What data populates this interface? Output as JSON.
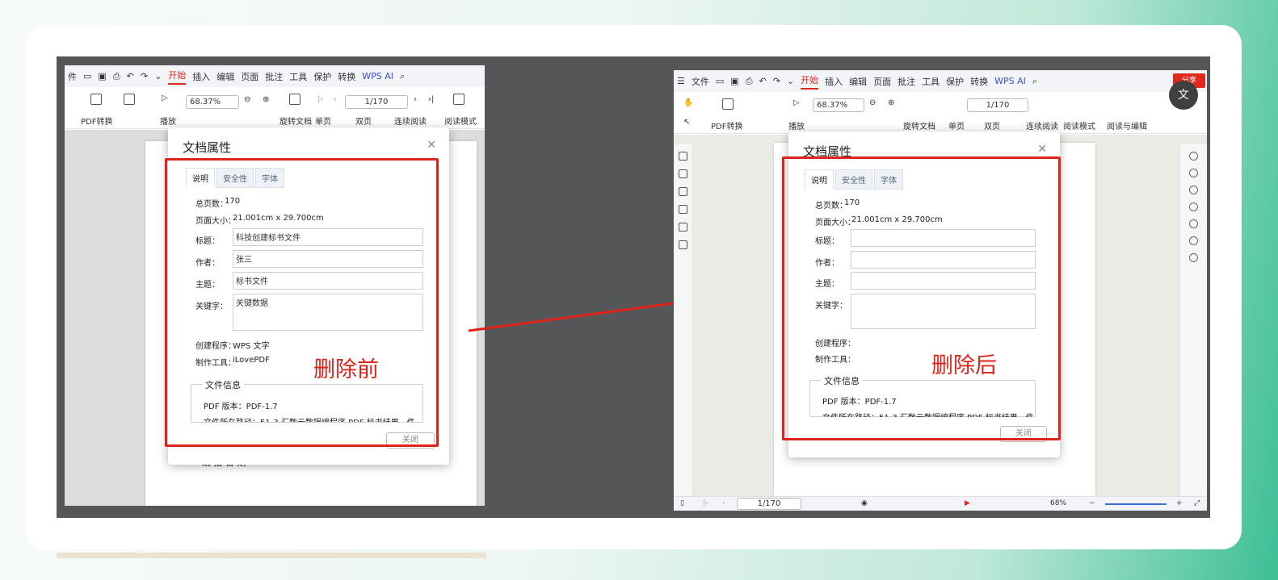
{
  "left": {
    "menu": [
      "件",
      "开始",
      "插入",
      "编辑",
      "页面",
      "批注",
      "工具",
      "保护",
      "转换",
      "WPS AI"
    ],
    "active_menu": "开始",
    "toolbar": {
      "pdf_convert": "PDF转换",
      "play": "播放",
      "zoom": "68.37%",
      "page": "1/170",
      "rotate": "旋转文档",
      "single": "单页",
      "double": "双页",
      "continuous": "连续阅读",
      "read_mode": "阅读模式"
    },
    "dialog": {
      "title": "文档属性",
      "tabs": [
        "说明",
        "安全性",
        "字体"
      ],
      "total_pages_label": "总页数：",
      "total_pages": "170",
      "page_size_label": "页面大小：",
      "page_size": "21.001cm x 29.700cm",
      "title_label": "标题：",
      "title_value": "科技创建标书文件",
      "author_label": "作者：",
      "author_value": "张三",
      "subject_label": "主题：",
      "subject_value": "标书文件",
      "keywords_label": "关键字：",
      "keywords_value": "关键数据",
      "creator_label": "创建程序：",
      "creator_value": "WPS 文字",
      "producer_label": "制作工具：",
      "producer_value": "iLovePDF",
      "file_info": "文件信息",
      "pdf_version": "PDF 版本：PDF-1.7",
      "file_path": "文件所在路径：51-3 汇数云数据编程序 PDF 标书结果 - 件",
      "close": "关闭"
    },
    "caption": "删除前",
    "below_text": "编 报 日 期"
  },
  "right": {
    "menu": [
      "文件",
      "开始",
      "插入",
      "编辑",
      "页面",
      "批注",
      "工具",
      "保护",
      "转换",
      "WPS AI"
    ],
    "active_menu": "开始",
    "share": "分享",
    "toolbar": {
      "pdf_convert": "PDF转换",
      "play": "播放",
      "zoom": "68.37%",
      "page": "1/170",
      "rotate": "旋转文档",
      "single": "单页",
      "double": "双页",
      "continuous": "连续阅读",
      "read_mode": "阅读模式",
      "read_edit": "阅读与编辑"
    },
    "dialog": {
      "title": "文档属性",
      "tabs": [
        "说明",
        "安全性",
        "字体"
      ],
      "total_pages_label": "总页数：",
      "total_pages": "170",
      "page_size_label": "页面大小：",
      "page_size": "21.001cm x 29.700cm",
      "title_label": "标题：",
      "author_label": "作者：",
      "subject_label": "主题：",
      "keywords_label": "关键字：",
      "creator_label": "创建程序：",
      "producer_label": "制作工具：",
      "file_info": "文件信息",
      "pdf_version": "PDF 版本：PDF-1.7",
      "file_path": "文件所在路径：51-3 汇数云数据编程序 PDF 标书结果 - 件",
      "close": "关闭"
    },
    "caption": "删除后",
    "status": {
      "page": "1/170",
      "zoom": "68%"
    }
  },
  "colors": {
    "accent_red": "#e0231a",
    "active_tab": "#e0281c"
  }
}
